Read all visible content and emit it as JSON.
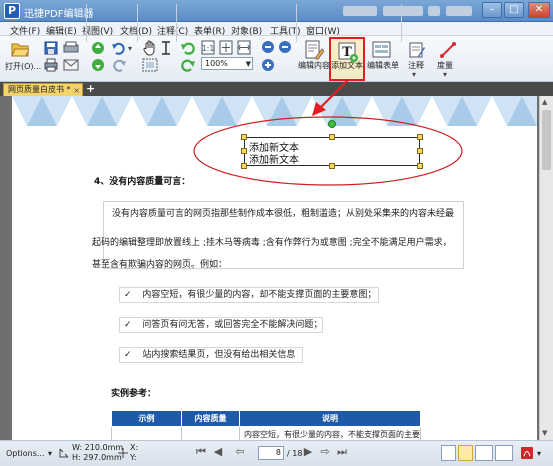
{
  "window": {
    "title": "迅捷PDF编辑器",
    "logo_letter": "P",
    "controls": {
      "minimize": "–",
      "maximize": "□",
      "close": "✕"
    }
  },
  "menu": [
    "文件(F)",
    "编辑(E)",
    "视图(V)",
    "文档(D)",
    "注释(C)",
    "表单(R)",
    "对象(B)",
    "工具(T)",
    "窗口(W)"
  ],
  "toolbar": {
    "open_label": "打开(O)...",
    "zoom_value": "100%",
    "edit_content_label": "编辑内容",
    "add_text_label": "添加文本",
    "edit_form_label": "编辑表单",
    "annotate_label": "注释",
    "measure_label": "度量",
    "text_tool_glyph": "T"
  },
  "tabs": {
    "document_tab": "网页质量白皮书 *",
    "add_tab": "+",
    "close": "×"
  },
  "document": {
    "textbox_lines": [
      "添加新文本",
      "添加新文本"
    ],
    "section_heading": "4、没有内容质量可言：",
    "paragraph_lines": [
      "没有内容质量可言的网页指那些制作成本很低，粗制滥造；从别处采集来的内容未经最",
      "起码的编辑整理即放置线上 ;挂木马等病毒 ;含有作弊行为或意图 ;完全不能满足用户需求，",
      "甚至含有欺骗内容的网页。例如："
    ],
    "check_glyph": "✓",
    "checklist": [
      "内容空短，有很少量的内容，却不能支撑页面的主要意图；",
      "问答页有问无答，或回答完全不能解决问题；",
      "站内搜索结果页，但没有给出相关信息"
    ],
    "example_heading": "实例参考：",
    "table": {
      "headers": [
        "示例",
        "内容质量",
        "说明"
      ],
      "first_row": [
        "",
        "",
        "内容空短，有很少量的内容，不能支撑页面的主要"
      ]
    }
  },
  "statusbar": {
    "options": "Options...",
    "width": "W: 210.0mm",
    "height": "H: 297.0mm",
    "x": "X:",
    "y": "Y:",
    "page_current": "8",
    "page_total": "/ 18"
  },
  "colors": {
    "highlight": "#e02020",
    "ellipse": "#e02020",
    "table_header": "#1e5aa8",
    "tab_active": "#f4d36a"
  }
}
